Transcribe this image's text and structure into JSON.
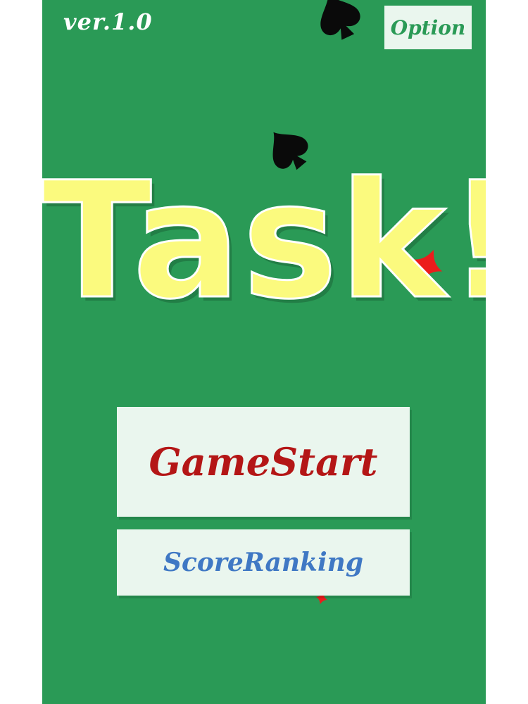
{
  "version": "ver.1.0",
  "option_label": "Option",
  "title": "Task!",
  "buttons": {
    "game_start": "GameStart",
    "score_ranking": "ScoreRanking"
  },
  "colors": {
    "background": "#2a9a56",
    "title": "#fbfa7e",
    "button_bg": "#eaf6ee",
    "game_start_text": "#b41616",
    "score_ranking_text": "#3f78c4",
    "option_text": "#2a9a56",
    "spade": "#0a0a0a",
    "diamond": "#ec1c1c"
  },
  "icons": {
    "spade_top": "spade-icon",
    "spade_mid": "spade-icon",
    "diamond_right": "diamond-icon",
    "diamond_bottom": "diamond-icon"
  }
}
